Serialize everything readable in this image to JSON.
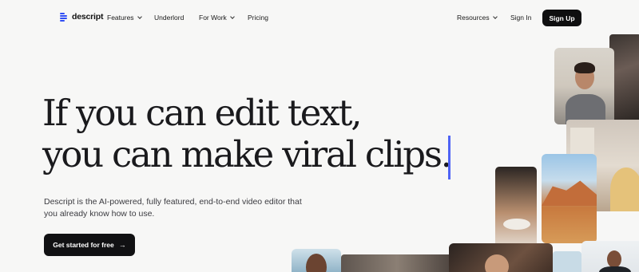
{
  "brand": {
    "logo_text": "descript"
  },
  "nav": {
    "items": [
      {
        "label": "Features",
        "has_dropdown": true
      },
      {
        "label": "Underlord",
        "has_dropdown": false
      },
      {
        "label": "For Work",
        "has_dropdown": true
      },
      {
        "label": "Pricing",
        "has_dropdown": false
      }
    ],
    "resources": {
      "label": "Resources",
      "has_dropdown": true
    },
    "sign_in": "Sign In",
    "sign_up": "Sign Up"
  },
  "hero": {
    "headline_line1": "If you can edit text,",
    "headline_line2": "you can make viral clips.",
    "subtitle": "Descript is the AI-powered, fully featured, end-to-end video editor that you already know how to use.",
    "cta_label": "Get started for free",
    "cta_icon": "arrow-right-icon"
  },
  "colors": {
    "accent": "#4f63f5",
    "logo_blue": "#2f4df5",
    "dark_button": "#111113",
    "background": "#f7f7f6"
  },
  "collage": {
    "description_tiles": [
      "selfie-video",
      "dark-room",
      "room-interior",
      "food-video",
      "desert-landscape",
      "man-portrait",
      "video-strip",
      "brown-scene",
      "blue-tile",
      "suit-portrait"
    ]
  }
}
